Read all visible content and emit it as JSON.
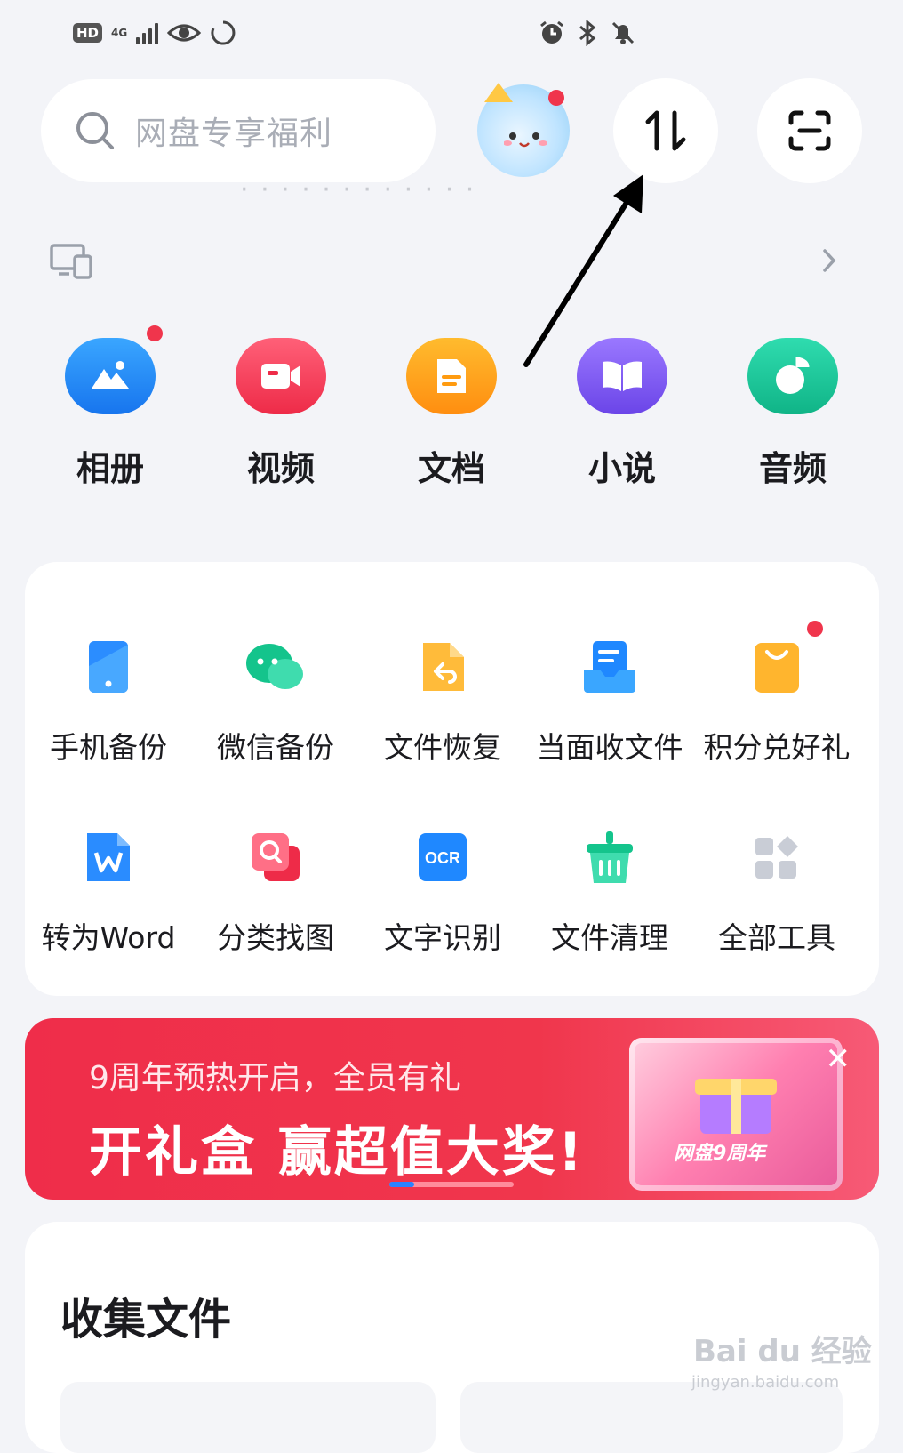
{
  "status_bar": {
    "hd": "HD",
    "net": "4G"
  },
  "search": {
    "placeholder": "网盘专享福利"
  },
  "categories": [
    {
      "label": "相册",
      "color": "#1f8ef5",
      "icon": "photo-album-icon"
    },
    {
      "label": "视频",
      "color": "#f13a55",
      "icon": "video-icon"
    },
    {
      "label": "文档",
      "color": "#ff9b10",
      "icon": "document-icon"
    },
    {
      "label": "小说",
      "color": "#7b5af0",
      "icon": "book-icon"
    },
    {
      "label": "音频",
      "color": "#18c49a",
      "icon": "audio-icon"
    }
  ],
  "tools": [
    {
      "label": "手机备份",
      "icon": "phone-backup-icon"
    },
    {
      "label": "微信备份",
      "icon": "wechat-backup-icon"
    },
    {
      "label": "文件恢复",
      "icon": "file-restore-icon"
    },
    {
      "label": "当面收文件",
      "icon": "receive-files-icon"
    },
    {
      "label": "积分兑好礼",
      "icon": "points-gift-icon"
    },
    {
      "label": "转为Word",
      "icon": "convert-word-icon"
    },
    {
      "label": "分类找图",
      "icon": "find-image-icon"
    },
    {
      "label": "文字识别",
      "icon": "ocr-icon"
    },
    {
      "label": "文件清理",
      "icon": "file-clean-icon"
    },
    {
      "label": "全部工具",
      "icon": "all-tools-icon"
    }
  ],
  "banner": {
    "subtitle": "9周年预热开启，全员有礼",
    "headline": "开礼盒 赢超值大奖!",
    "gift_text": "网盘9周年",
    "close": "✕"
  },
  "collect": {
    "title": "收集文件"
  },
  "watermark": {
    "main": "Bai du 经验",
    "url": "jingyan.baidu.com"
  }
}
